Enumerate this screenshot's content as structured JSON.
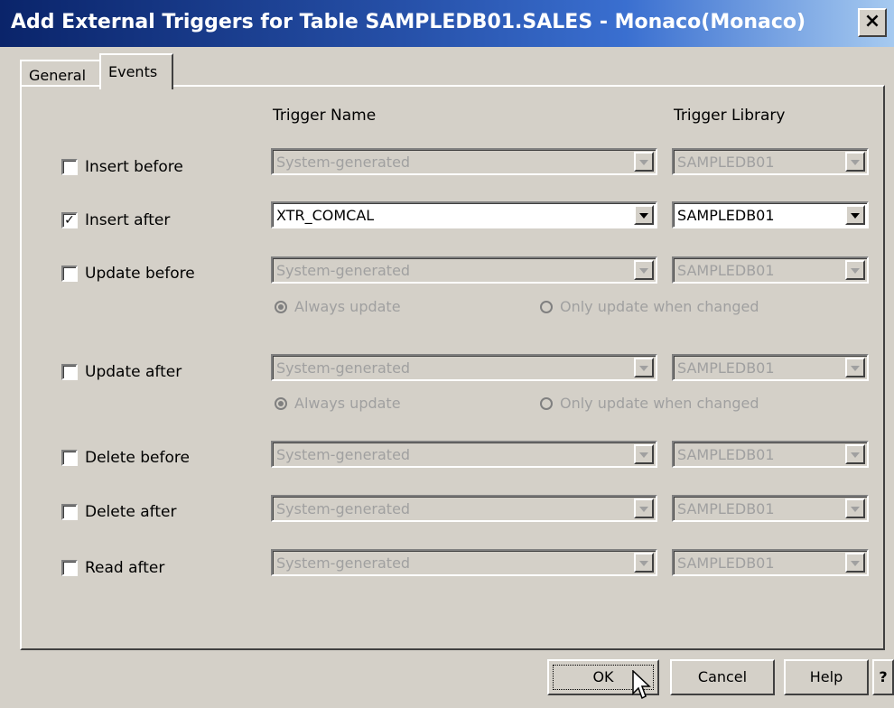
{
  "window": {
    "title": "Add External Triggers for Table  SAMPLEDB01.SALES   - Monaco(Monaco)",
    "close_glyph": "×"
  },
  "tabs": [
    {
      "label": "General",
      "active": false
    },
    {
      "label": "Events",
      "active": true
    }
  ],
  "columns": {
    "trigger_name": "Trigger Name",
    "trigger_library": "Trigger Library"
  },
  "events": [
    {
      "label": "Insert before",
      "checked": false,
      "name_value": "System-generated",
      "library_value": "SAMPLEDB01",
      "enabled": false
    },
    {
      "label": "Insert after",
      "checked": true,
      "name_value": "XTR_COMCAL",
      "library_value": "SAMPLEDB01",
      "enabled": true
    },
    {
      "label": "Update before",
      "checked": false,
      "name_value": "System-generated",
      "library_value": "SAMPLEDB01",
      "enabled": false,
      "radios": {
        "always": "Always update",
        "only": "Only update when changed",
        "selected": "always"
      }
    },
    {
      "label": "Update after",
      "checked": false,
      "name_value": "System-generated",
      "library_value": "SAMPLEDB01",
      "enabled": false,
      "radios": {
        "always": "Always update",
        "only": "Only update when changed",
        "selected": "always"
      }
    },
    {
      "label": "Delete before",
      "checked": false,
      "name_value": "System-generated",
      "library_value": "SAMPLEDB01",
      "enabled": false
    },
    {
      "label": "Delete after",
      "checked": false,
      "name_value": "System-generated",
      "library_value": "SAMPLEDB01",
      "enabled": false
    },
    {
      "label": "Read after",
      "checked": false,
      "name_value": "System-generated",
      "library_value": "SAMPLEDB01",
      "enabled": false
    }
  ],
  "buttons": {
    "ok": "OK",
    "cancel": "Cancel",
    "help": "Help",
    "question": "?"
  },
  "colors": {
    "titlebar_start": "#0a246a",
    "titlebar_end": "#a6caf0",
    "face": "#d4d0c8",
    "disabled_text": "#a0a0a0"
  }
}
